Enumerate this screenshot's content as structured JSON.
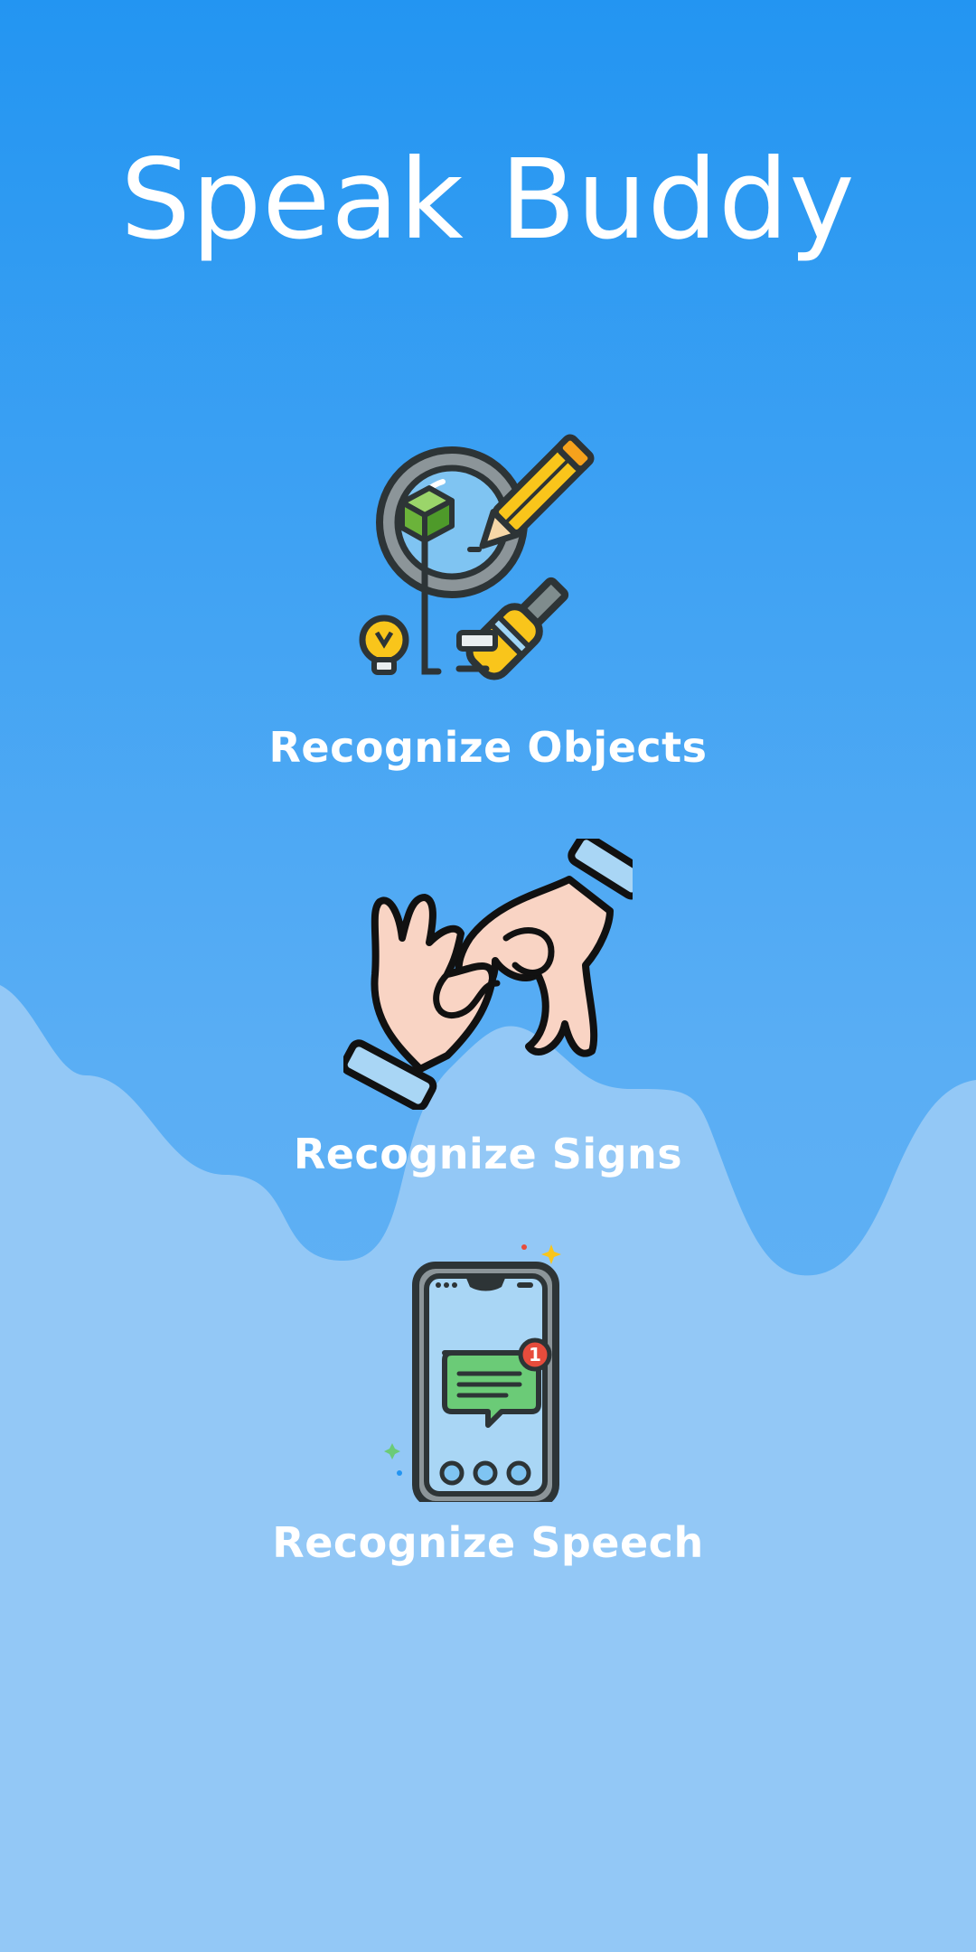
{
  "app": {
    "title": "Speak Buddy"
  },
  "features": [
    {
      "label": "Recognize Objects",
      "icon": "magnifier-pencil-icon"
    },
    {
      "label": "Recognize Signs",
      "icon": "sign-language-hands-icon"
    },
    {
      "label": "Recognize Speech",
      "icon": "phone-message-icon"
    }
  ],
  "notification": {
    "count": "1"
  },
  "colors": {
    "background_top": "#2395F2",
    "background_bottom": "#6BB5F4",
    "wave": "#93C8F6",
    "text": "#FFFFFF"
  }
}
